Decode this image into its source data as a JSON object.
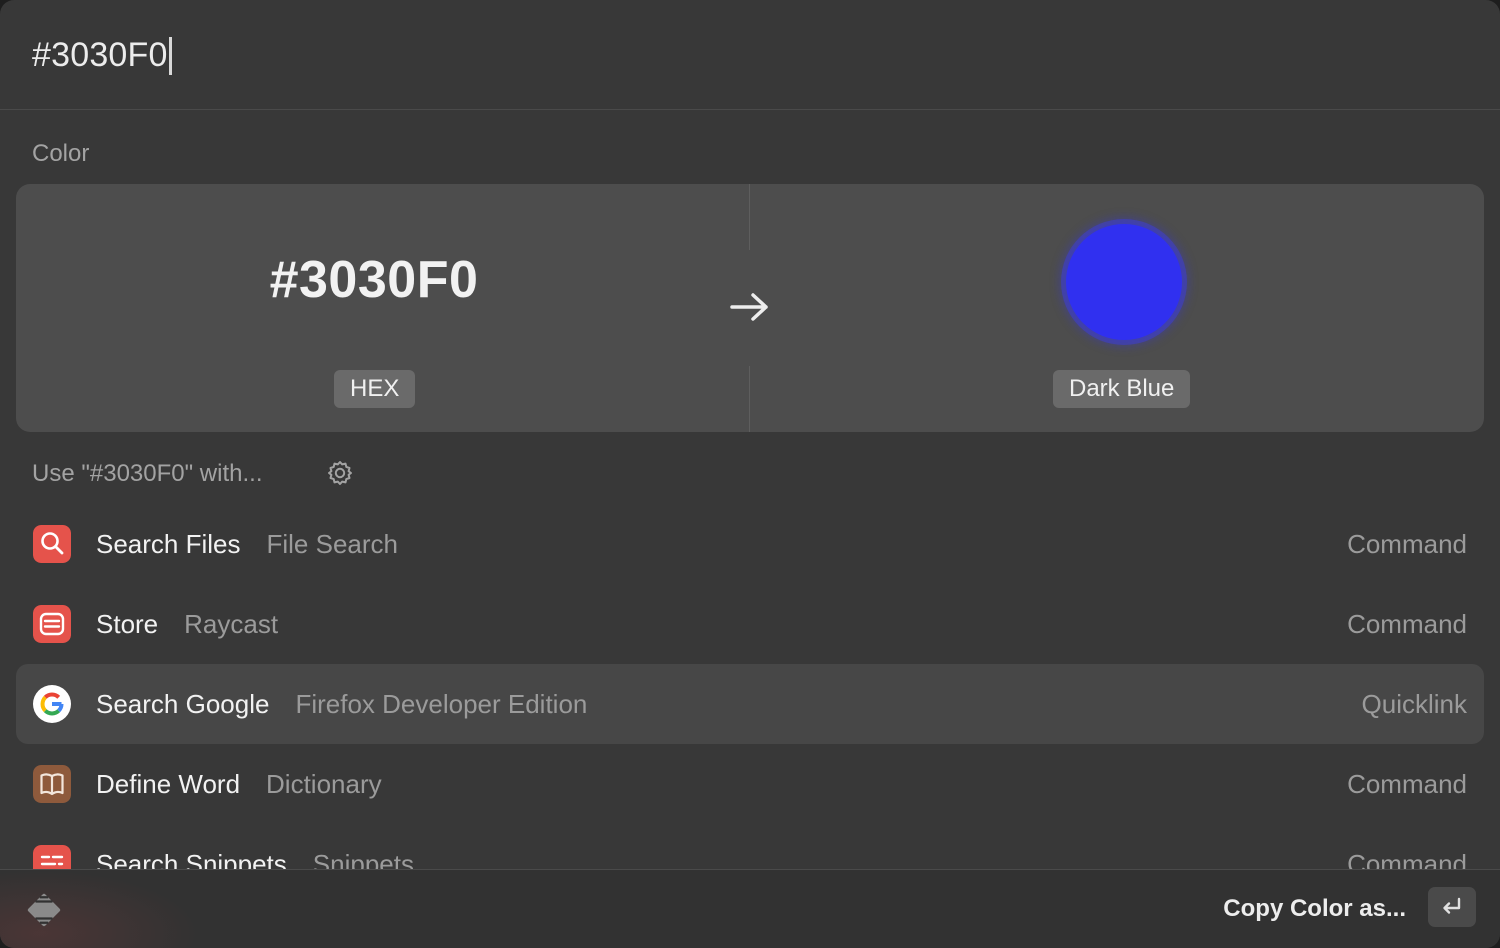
{
  "search": {
    "query": "#3030F0"
  },
  "color_section": {
    "label": "Color",
    "input_value": "#3030F0",
    "input_format": "HEX",
    "swatch_color": "#3030F0",
    "color_name": "Dark Blue"
  },
  "use_with": {
    "label": "Use \"#3030F0\" with...",
    "settings_icon": "gear-icon"
  },
  "results": [
    {
      "title": "Search Files",
      "subtitle": "File Search",
      "accessory": "Command",
      "icon": "magnifier-icon",
      "icon_color": "#e5534b",
      "selected": false
    },
    {
      "title": "Store",
      "subtitle": "Raycast",
      "accessory": "Command",
      "icon": "store-icon",
      "icon_color": "#e5534b",
      "selected": false
    },
    {
      "title": "Search Google",
      "subtitle": "Firefox Developer Edition",
      "accessory": "Quicklink",
      "icon": "google-icon",
      "icon_color": "#ffffff",
      "selected": true
    },
    {
      "title": "Define Word",
      "subtitle": "Dictionary",
      "accessory": "Command",
      "icon": "book-icon",
      "icon_color": "#8e5a3c",
      "selected": false
    },
    {
      "title": "Search Snippets",
      "subtitle": "Snippets",
      "accessory": "Command",
      "icon": "snippets-icon",
      "icon_color": "#e5534b",
      "selected": false
    }
  ],
  "footer": {
    "logo_icon": "raycast-logo-icon",
    "primary_action": "Copy Color as...",
    "shortcut_icon": "return-key-icon"
  }
}
